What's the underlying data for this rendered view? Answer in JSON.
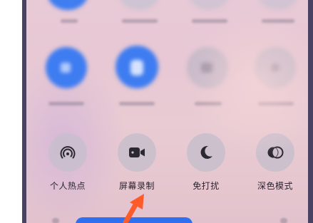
{
  "quick_settings": {
    "tiles": [
      {
        "label": "个人热点",
        "icon": "hotspot-icon"
      },
      {
        "label": "屏幕录制",
        "icon": "screen-record-icon"
      },
      {
        "label": "免打扰",
        "icon": "moon-icon"
      },
      {
        "label": "深色模式",
        "icon": "dark-mode-icon"
      }
    ],
    "highlighted_tile": "屏幕录制"
  },
  "colors": {
    "accent_blue": "#2f6ff0",
    "arrow": "#ff5a2a",
    "tile_bg": "#cbbfcd",
    "icon": "#2b2830"
  }
}
